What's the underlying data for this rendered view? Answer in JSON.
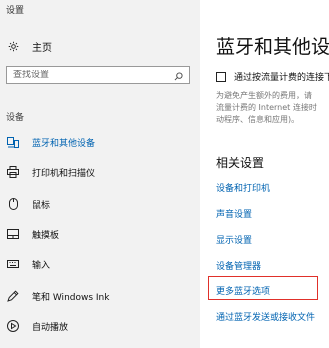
{
  "window": {
    "title": "设置"
  },
  "sidebar": {
    "home_label": "主页",
    "search_placeholder": "查找设置",
    "section_label": "设备",
    "items": [
      {
        "label": "蓝牙和其他设备",
        "icon": "bluetooth-devices-icon",
        "active": true
      },
      {
        "label": "打印机和扫描仪",
        "icon": "printer-icon",
        "active": false
      },
      {
        "label": "鼠标",
        "icon": "mouse-icon",
        "active": false
      },
      {
        "label": "触摸板",
        "icon": "touchpad-icon",
        "active": false
      },
      {
        "label": "输入",
        "icon": "keyboard-icon",
        "active": false
      },
      {
        "label": "笔和 Windows Ink",
        "icon": "pen-icon",
        "active": false
      },
      {
        "label": "自动播放",
        "icon": "autoplay-icon",
        "active": false
      }
    ]
  },
  "main": {
    "title": "蓝牙和其他设备",
    "metered_checkbox": {
      "label": "通过按流量计费的连接下载",
      "checked": false
    },
    "metered_description": {
      "line1": "为避免产生额外的费用，请",
      "line2": "流量计费的 Internet 连接时",
      "line3": "动程序、信息和应用)。"
    },
    "related_title": "相关设置",
    "links": [
      "设备和打印机",
      "声音设置",
      "显示设置",
      "设备管理器",
      "更多蓝牙选项",
      "通过蓝牙发送或接收文件"
    ]
  },
  "colors": {
    "accent": "#0063b1",
    "sidebar_bg": "#f2f2f2",
    "highlight_border": "#e0302a"
  }
}
